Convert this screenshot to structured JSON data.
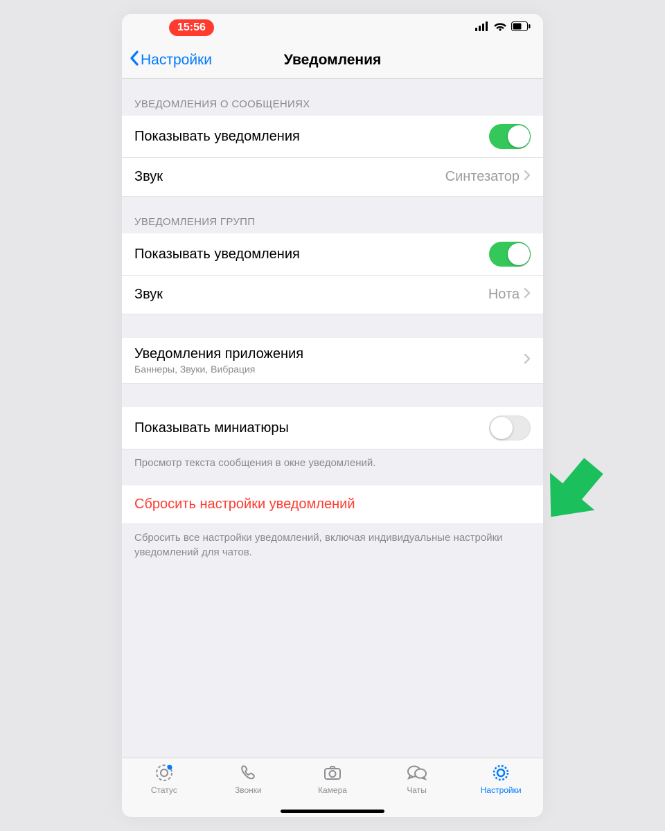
{
  "statusbar": {
    "time": "15:56"
  },
  "nav": {
    "back": "Настройки",
    "title": "Уведомления"
  },
  "sections": {
    "messages": {
      "header": "УВЕДОМЛЕНИЯ О СООБЩЕНИЯХ",
      "show": {
        "label": "Показывать уведомления",
        "on": true
      },
      "sound": {
        "label": "Звук",
        "value": "Синтезатор"
      }
    },
    "groups": {
      "header": "УВЕДОМЛЕНИЯ ГРУПП",
      "show": {
        "label": "Показывать уведомления",
        "on": true
      },
      "sound": {
        "label": "Звук",
        "value": "Нота"
      }
    },
    "app": {
      "label": "Уведомления приложения",
      "sub": "Баннеры, Звуки, Вибрация"
    },
    "preview": {
      "label": "Показывать миниатюры",
      "on": false,
      "footer": "Просмотр текста сообщения в окне уведомлений."
    },
    "reset": {
      "label": "Сбросить настройки уведомлений",
      "footer": "Сбросить все настройки уведомлений, включая индивидуальные настройки уведомлений для чатов."
    }
  },
  "tabs": {
    "status": "Статус",
    "calls": "Звонки",
    "camera": "Камера",
    "chats": "Чаты",
    "settings": "Настройки"
  },
  "colors": {
    "accent": "#007aff",
    "green": "#34c759",
    "destructive": "#ff3b30"
  }
}
